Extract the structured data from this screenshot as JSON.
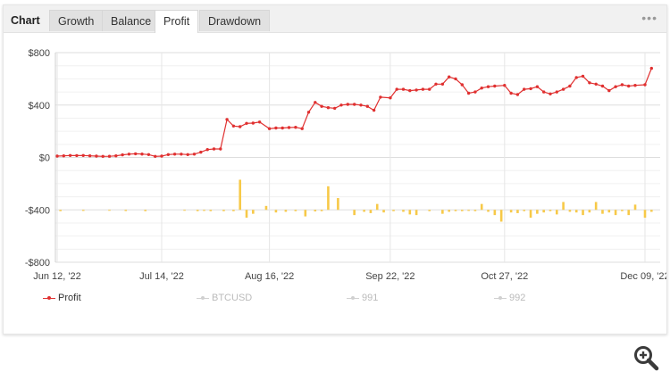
{
  "tabs": {
    "chart_label": "Chart",
    "growth_label": "Growth",
    "balance_label": "Balance",
    "profit_label": "Profit",
    "drawdown_label": "Drawdown",
    "menu_label": "•••"
  },
  "colors": {
    "profit_line": "#e03030",
    "bars": "#f7c948",
    "grid": "#e6e6e6",
    "muted_legend": "#bbbbbb"
  },
  "chart_data": {
    "type": "line",
    "title": "",
    "xlabel": "",
    "ylabel": "",
    "ylim": [
      -800,
      800
    ],
    "y_ticks": [
      800,
      400,
      0,
      -400,
      -800
    ],
    "y_tick_labels": [
      "$800",
      "$400",
      "$0",
      "-$400",
      "-$800"
    ],
    "x_ticks": [
      "2022-06-12",
      "2022-07-14",
      "2022-08-16",
      "2022-09-22",
      "2022-10-27",
      "2022-12-09"
    ],
    "x_tick_labels": [
      "Jun 12, '22",
      "Jul 14, '22",
      "Aug 16, '22",
      "Sep 22, '22",
      "Oct 27, '22",
      "Dec 09, '22"
    ],
    "grid": true,
    "legend_position": "bottom-left",
    "series": [
      {
        "name": "Profit",
        "type": "line",
        "x": [
          "2022-06-12",
          "2022-06-14",
          "2022-06-16",
          "2022-06-18",
          "2022-06-20",
          "2022-06-22",
          "2022-06-24",
          "2022-06-26",
          "2022-06-28",
          "2022-06-30",
          "2022-07-02",
          "2022-07-04",
          "2022-07-06",
          "2022-07-08",
          "2022-07-10",
          "2022-07-12",
          "2022-07-14",
          "2022-07-16",
          "2022-07-18",
          "2022-07-20",
          "2022-07-22",
          "2022-07-24",
          "2022-07-26",
          "2022-07-28",
          "2022-07-30",
          "2022-08-01",
          "2022-08-03",
          "2022-08-05",
          "2022-08-07",
          "2022-08-09",
          "2022-08-11",
          "2022-08-13",
          "2022-08-16",
          "2022-08-18",
          "2022-08-20",
          "2022-08-22",
          "2022-08-24",
          "2022-08-26",
          "2022-08-28",
          "2022-08-30",
          "2022-09-01",
          "2022-09-03",
          "2022-09-05",
          "2022-09-07",
          "2022-09-09",
          "2022-09-11",
          "2022-09-13",
          "2022-09-15",
          "2022-09-17",
          "2022-09-19",
          "2022-09-22",
          "2022-09-24",
          "2022-09-26",
          "2022-09-28",
          "2022-09-30",
          "2022-10-02",
          "2022-10-04",
          "2022-10-06",
          "2022-10-08",
          "2022-10-10",
          "2022-10-12",
          "2022-10-14",
          "2022-10-16",
          "2022-10-18",
          "2022-10-20",
          "2022-10-22",
          "2022-10-24",
          "2022-10-27",
          "2022-10-29",
          "2022-10-31",
          "2022-11-02",
          "2022-11-04",
          "2022-11-06",
          "2022-11-08",
          "2022-11-10",
          "2022-11-12",
          "2022-11-14",
          "2022-11-16",
          "2022-11-18",
          "2022-11-20",
          "2022-11-22",
          "2022-11-24",
          "2022-11-26",
          "2022-11-28",
          "2022-11-30",
          "2022-12-02",
          "2022-12-04",
          "2022-12-06",
          "2022-12-09",
          "2022-12-11"
        ],
        "values": [
          10,
          12,
          15,
          14,
          15,
          12,
          10,
          8,
          9,
          12,
          20,
          25,
          28,
          26,
          22,
          8,
          10,
          22,
          25,
          25,
          22,
          25,
          40,
          60,
          65,
          65,
          290,
          240,
          235,
          260,
          262,
          270,
          220,
          225,
          225,
          228,
          230,
          220,
          345,
          420,
          390,
          380,
          375,
          400,
          405,
          405,
          400,
          390,
          360,
          460,
          455,
          520,
          520,
          510,
          515,
          520,
          520,
          560,
          560,
          615,
          600,
          555,
          490,
          500,
          530,
          540,
          545,
          550,
          490,
          480,
          520,
          525,
          540,
          500,
          485,
          500,
          520,
          545,
          610,
          620,
          570,
          560,
          545,
          510,
          540,
          555,
          545,
          550,
          555,
          680
        ]
      },
      {
        "name": "BTCUSD",
        "type": "bar",
        "x": [
          "2022-06-13",
          "2022-06-20",
          "2022-06-28",
          "2022-07-03",
          "2022-07-09",
          "2022-07-21",
          "2022-07-25",
          "2022-07-27",
          "2022-07-29",
          "2022-08-02",
          "2022-08-05",
          "2022-08-07",
          "2022-08-09",
          "2022-08-11",
          "2022-08-15",
          "2022-08-18",
          "2022-08-21",
          "2022-08-24",
          "2022-08-27",
          "2022-08-30",
          "2022-09-01",
          "2022-09-03",
          "2022-09-06",
          "2022-09-11",
          "2022-09-14",
          "2022-09-16",
          "2022-09-18",
          "2022-09-20",
          "2022-09-23",
          "2022-09-26",
          "2022-09-28",
          "2022-09-30",
          "2022-10-04",
          "2022-10-08",
          "2022-10-10",
          "2022-10-12",
          "2022-10-14",
          "2022-10-16",
          "2022-10-18",
          "2022-10-20",
          "2022-10-22",
          "2022-10-24",
          "2022-10-26",
          "2022-10-29",
          "2022-10-31",
          "2022-11-02",
          "2022-11-04",
          "2022-11-06",
          "2022-11-08",
          "2022-11-10",
          "2022-11-12",
          "2022-11-14",
          "2022-11-16",
          "2022-11-18",
          "2022-11-20",
          "2022-11-22",
          "2022-11-24",
          "2022-11-26",
          "2022-11-28",
          "2022-11-30",
          "2022-12-02",
          "2022-12-04",
          "2022-12-06",
          "2022-12-09",
          "2022-12-11"
        ],
        "values": [
          -10,
          -8,
          -6,
          -9,
          -10,
          -6,
          -10,
          -8,
          -10,
          -10,
          -10,
          230,
          -60,
          -30,
          30,
          -20,
          -15,
          -10,
          -50,
          -12,
          -10,
          180,
          90,
          -40,
          -15,
          -25,
          45,
          -20,
          -10,
          -15,
          -35,
          -40,
          -10,
          -30,
          -15,
          -10,
          -10,
          -8,
          -10,
          45,
          -15,
          -40,
          -90,
          -20,
          -25,
          -10,
          -60,
          -30,
          -20,
          -10,
          -35,
          60,
          -15,
          -20,
          -40,
          -20,
          60,
          -30,
          -20,
          -40,
          -10,
          -40,
          40,
          -60,
          -15
        ]
      },
      {
        "name": "991"
      },
      {
        "name": "992"
      }
    ]
  }
}
